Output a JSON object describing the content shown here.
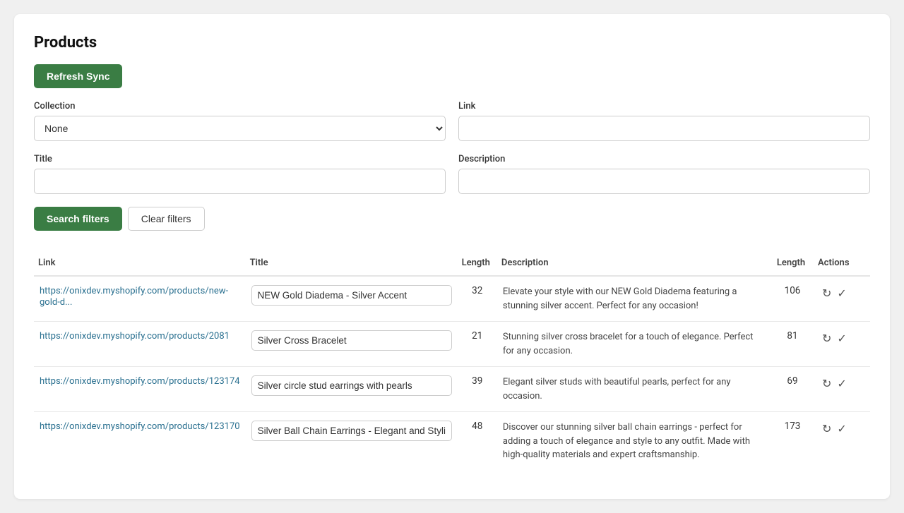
{
  "page": {
    "title": "Products"
  },
  "buttons": {
    "refresh_sync": "Refresh Sync",
    "search_filters": "Search filters",
    "clear_filters": "Clear filters"
  },
  "form": {
    "collection_label": "Collection",
    "collection_value": "None",
    "collection_options": [
      "None"
    ],
    "link_label": "Link",
    "link_placeholder": "",
    "title_label": "Title",
    "title_placeholder": "",
    "description_label": "Description",
    "description_placeholder": ""
  },
  "table": {
    "headers": {
      "link": "Link",
      "title": "Title",
      "length_title": "Length",
      "description": "Description",
      "length_desc": "Length",
      "actions": "Actions"
    },
    "rows": [
      {
        "link_url": "https://onixdev.myshopify.com/products/new-gold-d...",
        "link_display": "https://onixdev.myshopify.com/products/new-gold-d...",
        "title": "NEW Gold Diadema - Silver Accent",
        "length_title": "32",
        "description": "Elevate your style with our NEW Gold Diadema featuring a stunning silver accent. Perfect for any occasion!",
        "length_desc": "106"
      },
      {
        "link_url": "https://onixdev.myshopify.com/products/2081",
        "link_display": "https://onixdev.myshopify.com/products/2081",
        "title": "Silver Cross Bracelet",
        "length_title": "21",
        "description": "Stunning silver cross bracelet for a touch of elegance. Perfect for any occasion.",
        "length_desc": "81"
      },
      {
        "link_url": "https://onixdev.myshopify.com/products/123174",
        "link_display": "https://onixdev.myshopify.com/products/123174",
        "title": "Silver circle stud earrings with pearls",
        "length_title": "39",
        "description": "Elegant silver studs with beautiful pearls, perfect for any occasion.",
        "length_desc": "69"
      },
      {
        "link_url": "https://onixdev.myshopify.com/products/123170",
        "link_display": "https://onixdev.myshopify.com/products/123170",
        "title": "Silver Ball Chain Earrings - Elegant and Stylish",
        "length_title": "48",
        "description": "Discover our stunning silver ball chain earrings - perfect for adding a touch of elegance and style to any outfit. Made with high-quality materials and expert craftsmanship.",
        "length_desc": "173"
      }
    ]
  }
}
